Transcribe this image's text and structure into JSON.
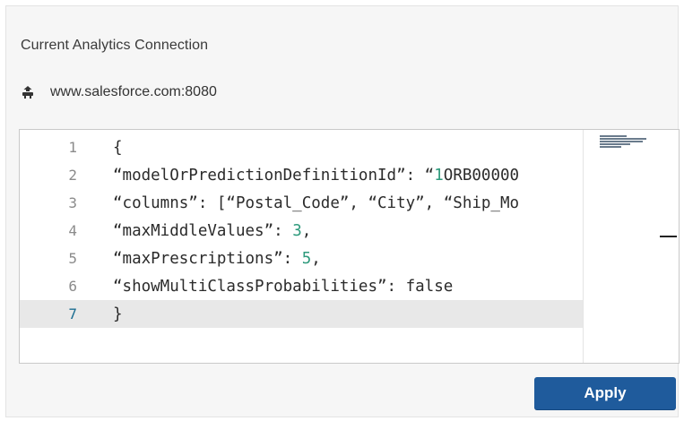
{
  "panel": {
    "title": "Current Analytics Connection",
    "connection_url": "www.salesforce.com:8080",
    "connection_icon": "connection-icon"
  },
  "editor": {
    "active_line": 7,
    "lines": [
      {
        "number": "1",
        "parts": [
          {
            "text": "{",
            "kind": "plain"
          }
        ]
      },
      {
        "number": "2",
        "parts": [
          {
            "text": "“modelOrPredictionDefinitionId”: “",
            "kind": "plain"
          },
          {
            "text": "1",
            "kind": "num"
          },
          {
            "text": "ORB00000",
            "kind": "plain"
          }
        ]
      },
      {
        "number": "3",
        "parts": [
          {
            "text": "“columns”: [“Postal_Code”, “City”, “Ship_Mo",
            "kind": "plain"
          }
        ]
      },
      {
        "number": "4",
        "parts": [
          {
            "text": "“maxMiddleValues”: ",
            "kind": "plain"
          },
          {
            "text": "3",
            "kind": "num"
          },
          {
            "text": ",",
            "kind": "plain"
          }
        ]
      },
      {
        "number": "5",
        "parts": [
          {
            "text": "“maxPrescriptions”: ",
            "kind": "plain"
          },
          {
            "text": "5",
            "kind": "num"
          },
          {
            "text": ",",
            "kind": "plain"
          }
        ]
      },
      {
        "number": "6",
        "parts": [
          {
            "text": "“showMultiClassProbabilities”: false",
            "kind": "plain"
          }
        ]
      },
      {
        "number": "7",
        "parts": [
          {
            "text": "}",
            "kind": "plain"
          }
        ]
      }
    ]
  },
  "actions": {
    "apply_label": "Apply"
  },
  "colors": {
    "apply_button": "#1f5b9c",
    "number_literal": "#2e9a7c",
    "active_line_number": "#1b6d91",
    "active_line_bg": "#e8e8e8"
  }
}
